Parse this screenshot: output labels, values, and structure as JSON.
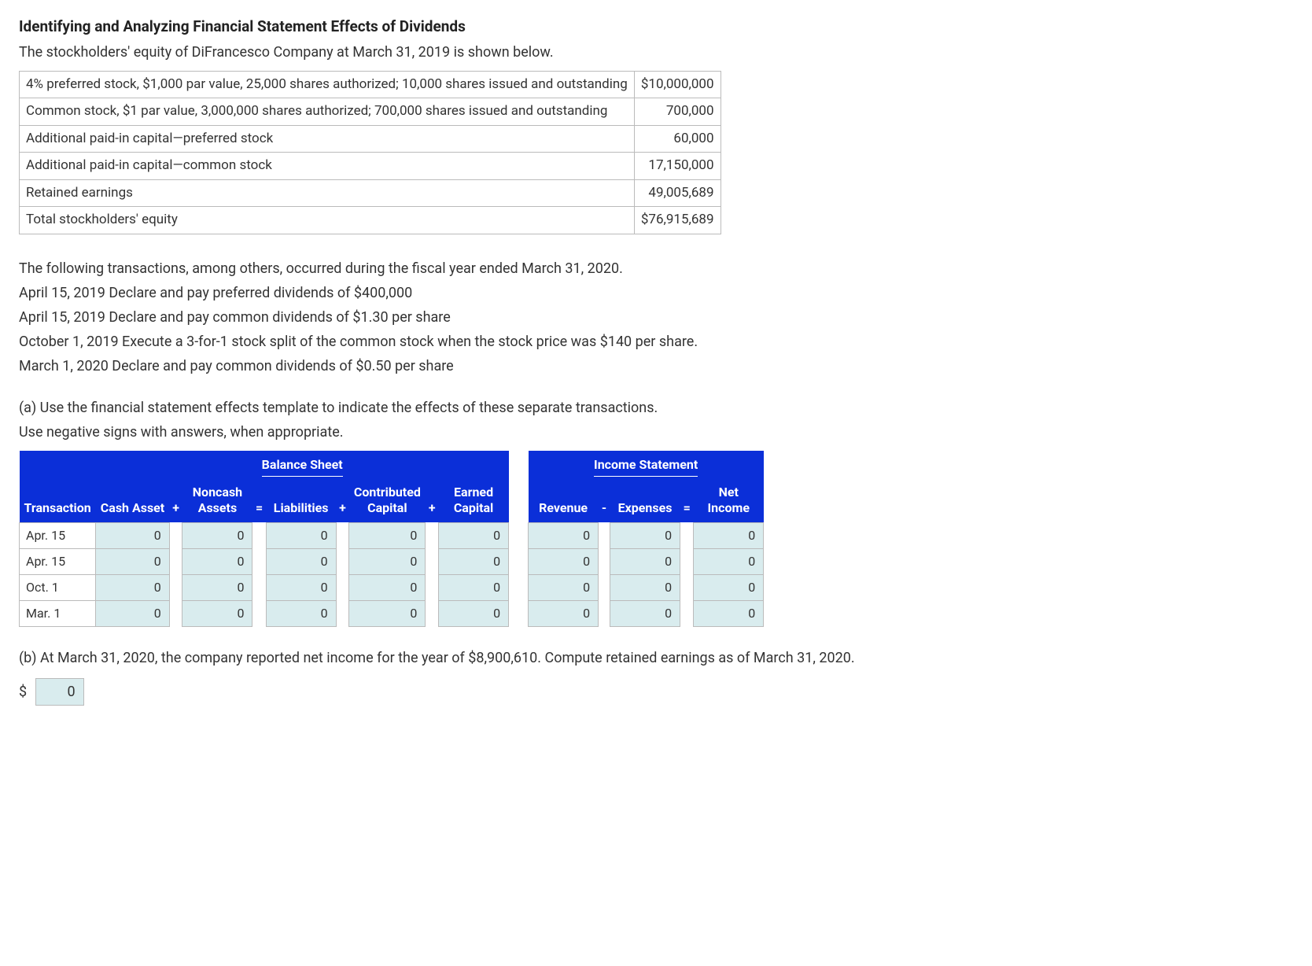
{
  "title": "Identifying and Analyzing Financial Statement Effects of Dividends",
  "intro": "The stockholders' equity of DiFrancesco Company at March 31, 2019 is shown below.",
  "equity_rows": [
    {
      "label": "4% preferred stock, $1,000 par value, 25,000 shares authorized; 10,000 shares issued and outstanding",
      "value": "$10,000,000"
    },
    {
      "label": "Common stock, $1 par value, 3,000,000 shares authorized; 700,000 shares issued and outstanding",
      "value": "700,000"
    },
    {
      "label": "Additional paid-in capital—preferred stock",
      "value": "60,000"
    },
    {
      "label": "Additional paid-in capital—common stock",
      "value": "17,150,000"
    },
    {
      "label": "Retained earnings",
      "value": "49,005,689"
    },
    {
      "label": "Total stockholders' equity",
      "value": "$76,915,689"
    }
  ],
  "transactions_intro": "The following transactions, among others, occurred during the fiscal year ended March 31, 2020.",
  "transactions": [
    "April 15, 2019 Declare and pay preferred dividends of $400,000",
    "April 15, 2019 Declare and pay common dividends of $1.30 per share",
    "October 1, 2019 Execute a 3-for-1 stock split of the common stock when the stock price was $140 per share.",
    "March 1, 2020 Declare and pay common dividends of $0.50 per share"
  ],
  "part_a_1": "(a) Use the financial statement effects template to indicate the effects of these separate transactions.",
  "part_a_2": "Use negative signs with answers, when appropriate.",
  "bs_title": "Balance Sheet",
  "is_title": "Income Statement",
  "headers": {
    "transaction": "Transaction",
    "cash_asset": "Cash Asset",
    "noncash_assets": "Noncash\nAssets",
    "liabilities": "Liabilities",
    "contrib_capital": "Contributed\nCapital",
    "earned_capital": "Earned\nCapital",
    "revenue": "Revenue",
    "expenses": "Expenses",
    "net_income": "Net\nIncome",
    "plus": "+",
    "equals": "=",
    "minus": "-"
  },
  "fs_rows": [
    {
      "label": "Apr. 15",
      "cash": "0",
      "noncash": "0",
      "liab": "0",
      "contrib": "0",
      "earned": "0",
      "rev": "0",
      "exp": "0",
      "ni": "0"
    },
    {
      "label": "Apr. 15",
      "cash": "0",
      "noncash": "0",
      "liab": "0",
      "contrib": "0",
      "earned": "0",
      "rev": "0",
      "exp": "0",
      "ni": "0"
    },
    {
      "label": "Oct. 1",
      "cash": "0",
      "noncash": "0",
      "liab": "0",
      "contrib": "0",
      "earned": "0",
      "rev": "0",
      "exp": "0",
      "ni": "0"
    },
    {
      "label": "Mar. 1",
      "cash": "0",
      "noncash": "0",
      "liab": "0",
      "contrib": "0",
      "earned": "0",
      "rev": "0",
      "exp": "0",
      "ni": "0"
    }
  ],
  "part_b": "(b) At March 31, 2020, the company reported net income for the year of $8,900,610. Compute retained earnings as of March 31, 2020.",
  "dollar": "$",
  "answer_value": "0"
}
